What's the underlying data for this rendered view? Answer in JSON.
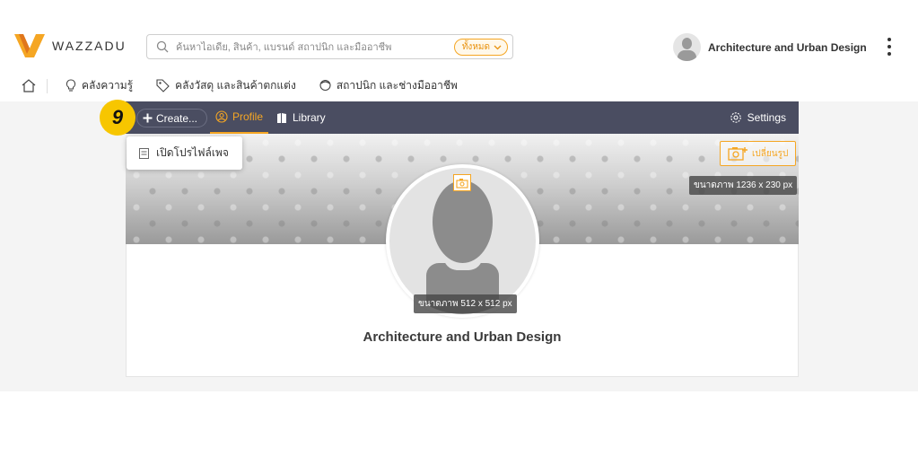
{
  "header": {
    "logo_text": "WAZZADU",
    "search": {
      "placeholder": "ค้นหาไอเดีย, สินค้า, แบรนด์ สถาปนิก และมืออาชีพ",
      "scope_label": "ทั้งหมด"
    },
    "user": {
      "name": "Architecture and Urban Design"
    }
  },
  "category_nav": {
    "items": [
      {
        "label": "คลังความรู้",
        "icon": "lightbulb-icon"
      },
      {
        "label": "คลังวัสดุ และสินค้าตกแต่ง",
        "icon": "tag-icon"
      },
      {
        "label": "สถาปนิก และช่างมืออาชีพ",
        "icon": "person-icon"
      }
    ]
  },
  "profile_bar": {
    "create_label": "Create...",
    "tabs": [
      {
        "label": "Profile",
        "active": true
      },
      {
        "label": "Library",
        "active": false
      }
    ],
    "settings_label": "Settings"
  },
  "create_menu": {
    "items": [
      {
        "label": "เปิดโปรไฟล์เพจ"
      }
    ]
  },
  "cover": {
    "change_label": "เปลี่ยนรูป",
    "size_text": "ขนาดภาพ 1236 x 230 px"
  },
  "avatar": {
    "size_text": "ขนาดภาพ 512 x 512 px"
  },
  "profile": {
    "name": "Architecture and Urban Design"
  },
  "step_badge": "9",
  "colors": {
    "accent": "#f5a623",
    "profile_bar": "#4a4d61",
    "badge": "#f7c600"
  }
}
